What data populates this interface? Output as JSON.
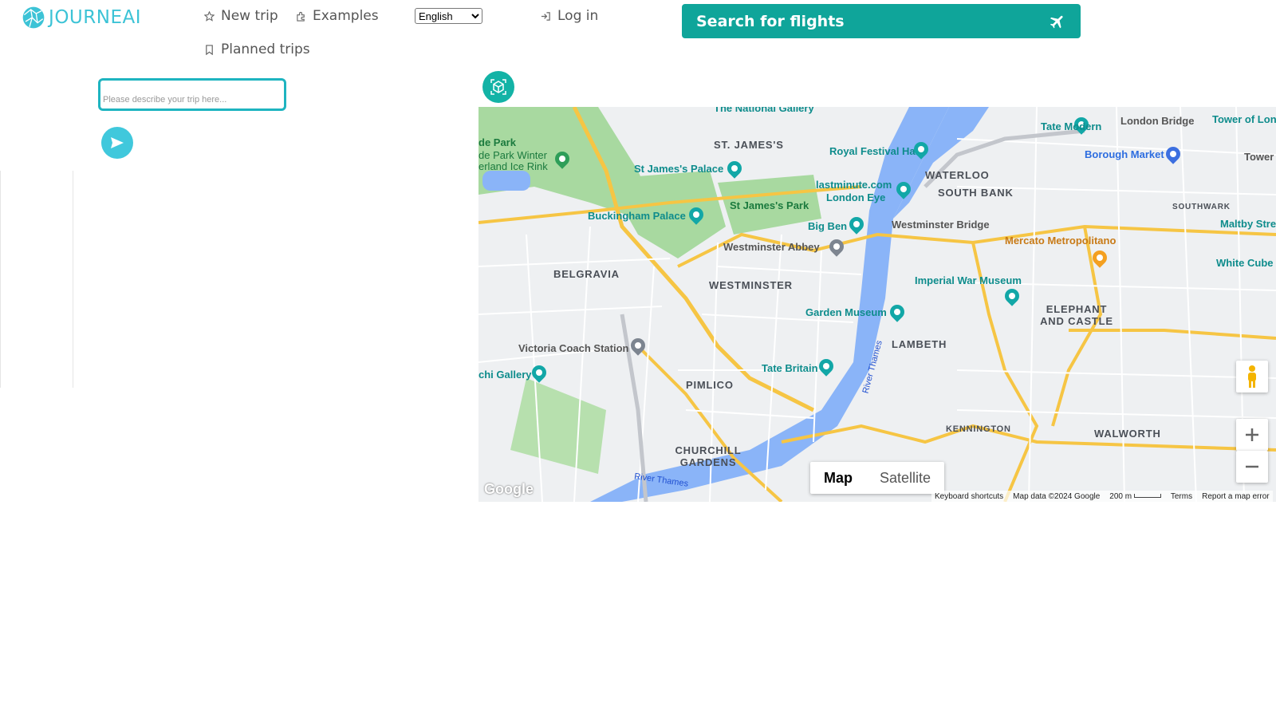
{
  "header": {
    "logo_text": "JOURNEAI",
    "nav": {
      "new_trip": "New trip",
      "examples": "Examples",
      "planned_trips": "Planned trips",
      "log_in": "Log in"
    },
    "language": {
      "selected": "English"
    },
    "search_flights": "Search for flights"
  },
  "left_panel": {
    "trip_input_placeholder": "Please describe your trip here..."
  },
  "map": {
    "areas": [
      "ST. JAMES'S",
      "WATERLOO",
      "SOUTH BANK",
      "BELGRAVIA",
      "WESTMINSTER",
      "ELEPHANT AND CASTLE",
      "LAMBETH",
      "PIMLICO",
      "KENNINGTON",
      "WALWORTH",
      "CHURCHILL GARDENS",
      "SOUTHWARK"
    ],
    "pois": [
      "The National Gallery",
      "Tate Modern",
      "London Bridge",
      "Tower of Lon",
      "Royal Festival Hall",
      "Borough Market",
      "Tower Br",
      "de Park",
      "de Park Winter",
      "erland Ice Rink",
      "St James's Palace",
      "lastminute.com",
      "London Eye",
      "Buckingham Palace",
      "St James's Park",
      "Big Ben",
      "Westminster Bridge",
      "Maltby Stre",
      "Mercato Metropolitano",
      "White Cube",
      "Westminster Abbey",
      "Imperial War Museum",
      "Garden Museum",
      "Victoria Coach Station",
      "chi Gallery",
      "Tate Britain"
    ],
    "rivers": [
      "River Thames",
      "River Thames"
    ],
    "map_type": {
      "map": "Map",
      "satellite": "Satellite"
    },
    "footer": {
      "keyboard": "Keyboard shortcuts",
      "map_data": "Map data ©2024 Google",
      "scale": "200 m",
      "terms": "Terms",
      "report": "Report a map error"
    },
    "google_logo": "Google"
  },
  "colors": {
    "accent_teal": "#0fa59a",
    "logo_blue": "#3cc3d6",
    "send_button": "#40c8dc",
    "water": "#8ab4f8",
    "park": "#a7d99a"
  }
}
